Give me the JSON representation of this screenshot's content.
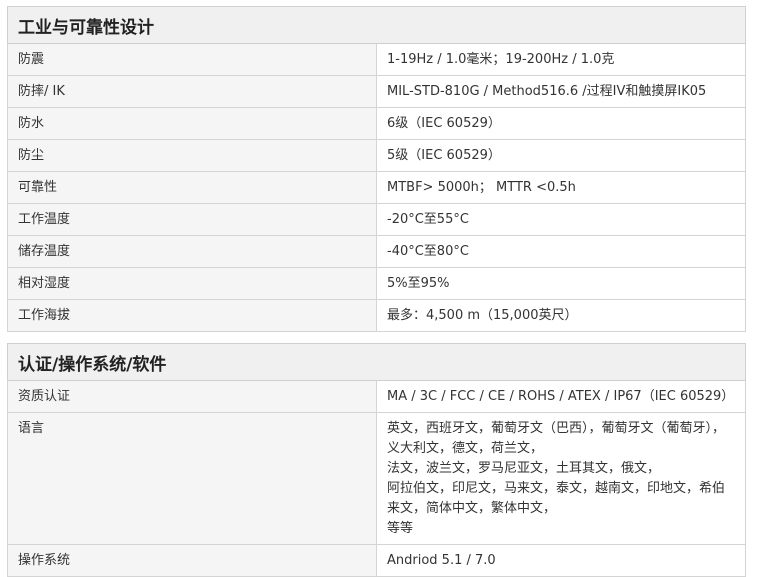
{
  "sections": [
    {
      "title": "工业与可靠性设计",
      "rows": [
        {
          "label": "防震",
          "value": "1-19Hz / 1.0毫米；19-200Hz / 1.0克"
        },
        {
          "label": "防摔/ IK",
          "value": "MIL-STD-810G / Method516.6 /过程IV和触摸屏IK05"
        },
        {
          "label": "防水",
          "value": "6级（IEC 60529）"
        },
        {
          "label": "防尘",
          "value": "5级（IEC 60529）"
        },
        {
          "label": "可靠性",
          "value": "MTBF> 5000h； MTTR <0.5h"
        },
        {
          "label": "工作温度",
          "value": "-20°C至55°C"
        },
        {
          "label": "储存温度",
          "value": "-40°C至80°C"
        },
        {
          "label": "相对湿度",
          "value": "5%至95%"
        },
        {
          "label": "工作海拔",
          "value": "最多：4,500 m（15,000英尺）"
        }
      ]
    },
    {
      "title": "认证/操作系统/软件",
      "rows": [
        {
          "label": "资质认证",
          "value": "MA / 3C / FCC / CE / ROHS / ATEX / IP67（IEC 60529）"
        },
        {
          "label": "语言",
          "lines": [
            "英文，西班牙文，葡萄牙文（巴西），葡萄牙文（葡萄牙），义大利文，德文，荷兰文，",
            "法文，波兰文，罗马尼亚文，土耳其文，俄文，",
            "阿拉伯文，印尼文，马来文，泰文，越南文，印地文，希伯来文，简体中文，繁体中文，",
            "等等"
          ]
        },
        {
          "label": "操作系统",
          "value": "Andriod 5.1 / 7.0"
        }
      ]
    }
  ]
}
